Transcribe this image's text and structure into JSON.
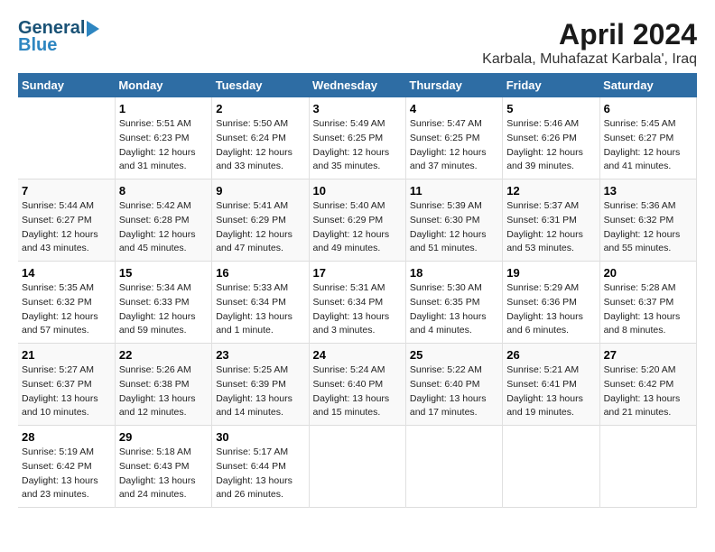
{
  "header": {
    "logo_general": "General",
    "logo_blue": "Blue",
    "title": "April 2024",
    "subtitle": "Karbala, Muhafazat Karbala', Iraq"
  },
  "calendar": {
    "days_of_week": [
      "Sunday",
      "Monday",
      "Tuesday",
      "Wednesday",
      "Thursday",
      "Friday",
      "Saturday"
    ],
    "weeks": [
      [
        {
          "day": "",
          "sunrise": "",
          "sunset": "",
          "daylight": ""
        },
        {
          "day": "1",
          "sunrise": "Sunrise: 5:51 AM",
          "sunset": "Sunset: 6:23 PM",
          "daylight": "Daylight: 12 hours and 31 minutes."
        },
        {
          "day": "2",
          "sunrise": "Sunrise: 5:50 AM",
          "sunset": "Sunset: 6:24 PM",
          "daylight": "Daylight: 12 hours and 33 minutes."
        },
        {
          "day": "3",
          "sunrise": "Sunrise: 5:49 AM",
          "sunset": "Sunset: 6:25 PM",
          "daylight": "Daylight: 12 hours and 35 minutes."
        },
        {
          "day": "4",
          "sunrise": "Sunrise: 5:47 AM",
          "sunset": "Sunset: 6:25 PM",
          "daylight": "Daylight: 12 hours and 37 minutes."
        },
        {
          "day": "5",
          "sunrise": "Sunrise: 5:46 AM",
          "sunset": "Sunset: 6:26 PM",
          "daylight": "Daylight: 12 hours and 39 minutes."
        },
        {
          "day": "6",
          "sunrise": "Sunrise: 5:45 AM",
          "sunset": "Sunset: 6:27 PM",
          "daylight": "Daylight: 12 hours and 41 minutes."
        }
      ],
      [
        {
          "day": "7",
          "sunrise": "Sunrise: 5:44 AM",
          "sunset": "Sunset: 6:27 PM",
          "daylight": "Daylight: 12 hours and 43 minutes."
        },
        {
          "day": "8",
          "sunrise": "Sunrise: 5:42 AM",
          "sunset": "Sunset: 6:28 PM",
          "daylight": "Daylight: 12 hours and 45 minutes."
        },
        {
          "day": "9",
          "sunrise": "Sunrise: 5:41 AM",
          "sunset": "Sunset: 6:29 PM",
          "daylight": "Daylight: 12 hours and 47 minutes."
        },
        {
          "day": "10",
          "sunrise": "Sunrise: 5:40 AM",
          "sunset": "Sunset: 6:29 PM",
          "daylight": "Daylight: 12 hours and 49 minutes."
        },
        {
          "day": "11",
          "sunrise": "Sunrise: 5:39 AM",
          "sunset": "Sunset: 6:30 PM",
          "daylight": "Daylight: 12 hours and 51 minutes."
        },
        {
          "day": "12",
          "sunrise": "Sunrise: 5:37 AM",
          "sunset": "Sunset: 6:31 PM",
          "daylight": "Daylight: 12 hours and 53 minutes."
        },
        {
          "day": "13",
          "sunrise": "Sunrise: 5:36 AM",
          "sunset": "Sunset: 6:32 PM",
          "daylight": "Daylight: 12 hours and 55 minutes."
        }
      ],
      [
        {
          "day": "14",
          "sunrise": "Sunrise: 5:35 AM",
          "sunset": "Sunset: 6:32 PM",
          "daylight": "Daylight: 12 hours and 57 minutes."
        },
        {
          "day": "15",
          "sunrise": "Sunrise: 5:34 AM",
          "sunset": "Sunset: 6:33 PM",
          "daylight": "Daylight: 12 hours and 59 minutes."
        },
        {
          "day": "16",
          "sunrise": "Sunrise: 5:33 AM",
          "sunset": "Sunset: 6:34 PM",
          "daylight": "Daylight: 13 hours and 1 minute."
        },
        {
          "day": "17",
          "sunrise": "Sunrise: 5:31 AM",
          "sunset": "Sunset: 6:34 PM",
          "daylight": "Daylight: 13 hours and 3 minutes."
        },
        {
          "day": "18",
          "sunrise": "Sunrise: 5:30 AM",
          "sunset": "Sunset: 6:35 PM",
          "daylight": "Daylight: 13 hours and 4 minutes."
        },
        {
          "day": "19",
          "sunrise": "Sunrise: 5:29 AM",
          "sunset": "Sunset: 6:36 PM",
          "daylight": "Daylight: 13 hours and 6 minutes."
        },
        {
          "day": "20",
          "sunrise": "Sunrise: 5:28 AM",
          "sunset": "Sunset: 6:37 PM",
          "daylight": "Daylight: 13 hours and 8 minutes."
        }
      ],
      [
        {
          "day": "21",
          "sunrise": "Sunrise: 5:27 AM",
          "sunset": "Sunset: 6:37 PM",
          "daylight": "Daylight: 13 hours and 10 minutes."
        },
        {
          "day": "22",
          "sunrise": "Sunrise: 5:26 AM",
          "sunset": "Sunset: 6:38 PM",
          "daylight": "Daylight: 13 hours and 12 minutes."
        },
        {
          "day": "23",
          "sunrise": "Sunrise: 5:25 AM",
          "sunset": "Sunset: 6:39 PM",
          "daylight": "Daylight: 13 hours and 14 minutes."
        },
        {
          "day": "24",
          "sunrise": "Sunrise: 5:24 AM",
          "sunset": "Sunset: 6:40 PM",
          "daylight": "Daylight: 13 hours and 15 minutes."
        },
        {
          "day": "25",
          "sunrise": "Sunrise: 5:22 AM",
          "sunset": "Sunset: 6:40 PM",
          "daylight": "Daylight: 13 hours and 17 minutes."
        },
        {
          "day": "26",
          "sunrise": "Sunrise: 5:21 AM",
          "sunset": "Sunset: 6:41 PM",
          "daylight": "Daylight: 13 hours and 19 minutes."
        },
        {
          "day": "27",
          "sunrise": "Sunrise: 5:20 AM",
          "sunset": "Sunset: 6:42 PM",
          "daylight": "Daylight: 13 hours and 21 minutes."
        }
      ],
      [
        {
          "day": "28",
          "sunrise": "Sunrise: 5:19 AM",
          "sunset": "Sunset: 6:42 PM",
          "daylight": "Daylight: 13 hours and 23 minutes."
        },
        {
          "day": "29",
          "sunrise": "Sunrise: 5:18 AM",
          "sunset": "Sunset: 6:43 PM",
          "daylight": "Daylight: 13 hours and 24 minutes."
        },
        {
          "day": "30",
          "sunrise": "Sunrise: 5:17 AM",
          "sunset": "Sunset: 6:44 PM",
          "daylight": "Daylight: 13 hours and 26 minutes."
        },
        {
          "day": "",
          "sunrise": "",
          "sunset": "",
          "daylight": ""
        },
        {
          "day": "",
          "sunrise": "",
          "sunset": "",
          "daylight": ""
        },
        {
          "day": "",
          "sunrise": "",
          "sunset": "",
          "daylight": ""
        },
        {
          "day": "",
          "sunrise": "",
          "sunset": "",
          "daylight": ""
        }
      ]
    ]
  }
}
